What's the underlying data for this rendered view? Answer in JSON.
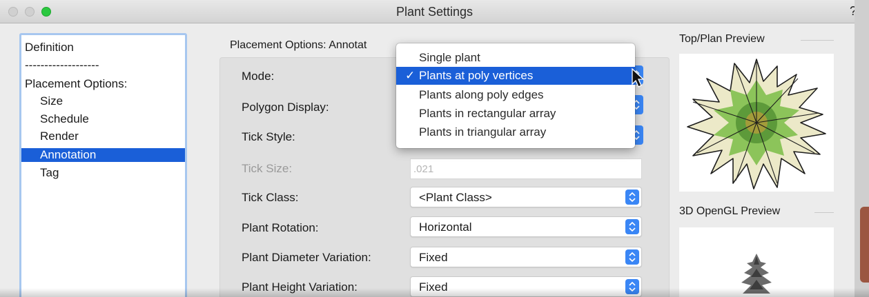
{
  "window": {
    "title": "Plant Settings",
    "help_label": "?"
  },
  "sidebar": {
    "items": [
      {
        "label": "Definition"
      },
      {
        "label": "-------------------"
      },
      {
        "label": "Placement Options:"
      },
      {
        "label": "Size"
      },
      {
        "label": "Schedule"
      },
      {
        "label": "Render"
      },
      {
        "label": "Annotation",
        "selected": true
      },
      {
        "label": "Tag"
      }
    ]
  },
  "main": {
    "section_label": "Placement Options: Annotat",
    "fields": {
      "mode": {
        "label": "Mode:"
      },
      "polygon_display": {
        "label": "Polygon Display:"
      },
      "tick_style": {
        "label": "Tick Style:"
      },
      "tick_size": {
        "label": "Tick Size:",
        "value": ".021",
        "disabled": true
      },
      "tick_class": {
        "label": "Tick Class:",
        "value": "<Plant Class>"
      },
      "plant_rotation": {
        "label": "Plant Rotation:",
        "value": "Horizontal"
      },
      "plant_diameter_variation": {
        "label": "Plant Diameter Variation:",
        "value": "Fixed"
      },
      "plant_height_variation": {
        "label": "Plant Height Variation:",
        "value": "Fixed"
      }
    }
  },
  "mode_menu": {
    "options": [
      {
        "label": "Single plant"
      },
      {
        "label": "Plants at poly vertices",
        "checked": true
      },
      {
        "label": "Plants along poly edges"
      },
      {
        "label": "Plants in rectangular array"
      },
      {
        "label": "Plants in triangular array"
      }
    ],
    "check_mark": "✓"
  },
  "previews": {
    "top_plan": {
      "title": "Top/Plan Preview"
    },
    "opengl": {
      "title": "3D OpenGL Preview"
    }
  },
  "colors": {
    "accent": "#1a5fd8",
    "stepper": "#3a86f5",
    "sidebar_border": "#a7c7ef",
    "zoom_button": "#2bc840"
  }
}
